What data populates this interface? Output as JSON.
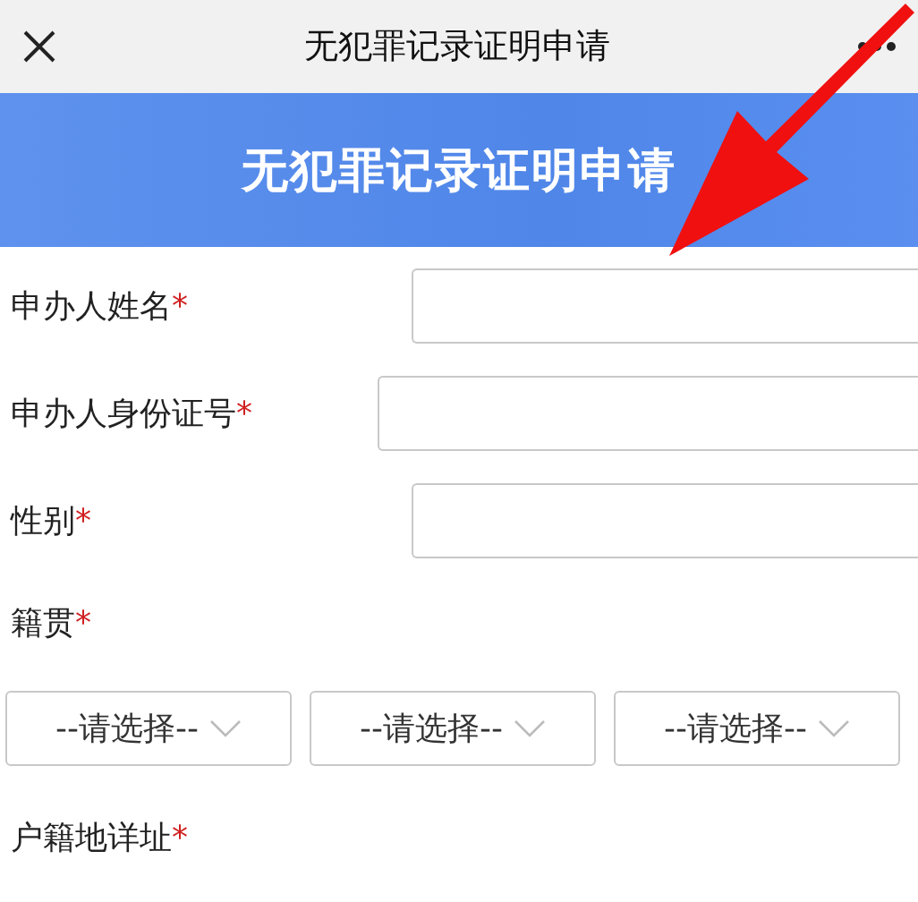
{
  "nav": {
    "title": "无犯罪记录证明申请"
  },
  "banner": {
    "title": "无犯罪记录证明申请"
  },
  "fields": [
    {
      "kind": "input",
      "label": "申办人姓名",
      "mark": "*"
    },
    {
      "kind": "input",
      "label": "申办人身份证号",
      "mark": "*"
    },
    {
      "kind": "input",
      "label": "性别",
      "mark": "*"
    },
    {
      "kind": "selects",
      "label": "籍贯",
      "mark": "*",
      "selects": [
        {
          "value": "--请选择--"
        },
        {
          "value": "--请选择--"
        },
        {
          "value": "--请选择--"
        }
      ]
    },
    {
      "kind": "heading",
      "label": "户籍地详址",
      "mark": "*"
    }
  ]
}
